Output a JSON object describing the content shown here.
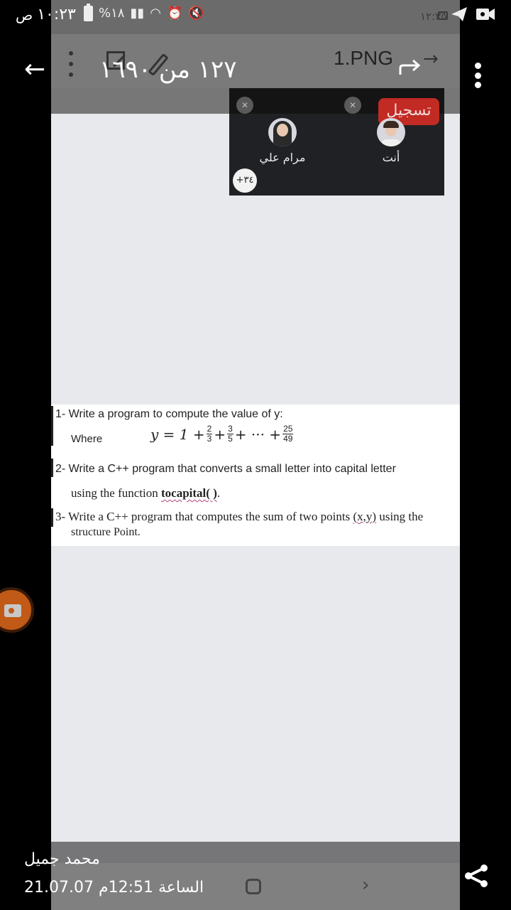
{
  "status_bar": {
    "clock": "١٠:٢٣",
    "am_pm": "ص",
    "battery_percent": "%١٨",
    "icons": [
      "battery-icon",
      "signal-icon",
      "wifi-icon",
      "alarm-icon",
      "mute-icon"
    ],
    "right_icons": [
      "telegram-icon",
      "video-record-icon"
    ]
  },
  "inner_status": {
    "time": "١٢:٣٥"
  },
  "viewer": {
    "page_counter": "١٢٧ من ١٦٩٠",
    "file_name": "1.PNG",
    "back_icon": "arrow-left-icon",
    "forward_icon": "arrow-right-icon"
  },
  "meeting": {
    "record_label": "تسجيل",
    "participants": [
      {
        "name": "مرام علي",
        "muted": true
      },
      {
        "name": "أنت",
        "muted": true
      }
    ],
    "more_count": "+٣٤"
  },
  "document": {
    "q1": "1- Write a program to compute the value of y:",
    "where_label": "Where",
    "formula": {
      "lhs": "y = 1 +",
      "terms": [
        {
          "num": "2",
          "den": "3"
        },
        {
          "num": "3",
          "den": "5"
        }
      ],
      "ellipsis": "+ ··· +",
      "last": {
        "num": "25",
        "den": "49"
      },
      "plus": "+"
    },
    "q2_line1": "2- Write a C++ program that converts a small letter into capital letter",
    "q2_line2_prefix": "using the function ",
    "q2_fn": "tocapital( )",
    "q2_line2_suffix": ".",
    "q3_line1_prefix": "3- Write a C++ program that computes the sum of two points ",
    "q3_xy": "(x,y)",
    "q3_line1_suffix": " using the",
    "q3_line2": "structure Point."
  },
  "footer": {
    "sender": "محمد جميل",
    "timestamp": "21.07.07 الساعة 12:51م"
  }
}
